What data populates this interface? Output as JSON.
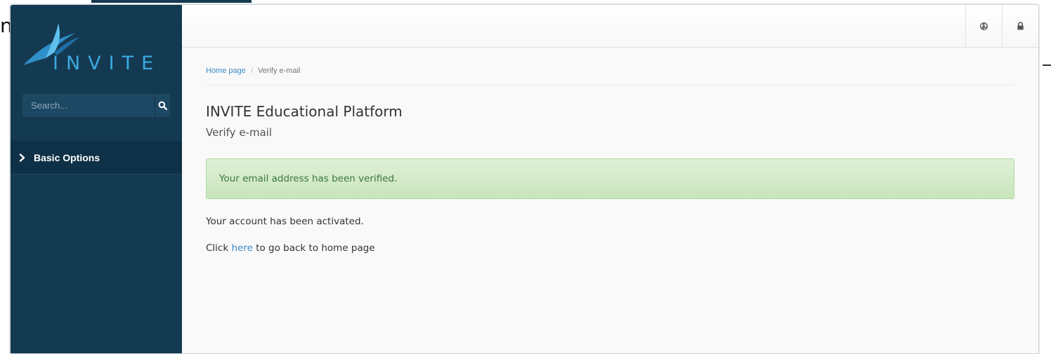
{
  "background": {
    "partial_letter": "n"
  },
  "sidebar": {
    "logo_text": "INVITE",
    "search": {
      "placeholder": "Search...",
      "button_icon": "search-icon"
    },
    "nav": [
      {
        "label": "Basic Options",
        "icon": "chevron-right-icon"
      }
    ]
  },
  "topbar": {
    "buttons": [
      {
        "icon": "globe-icon"
      },
      {
        "icon": "lock-icon"
      }
    ]
  },
  "breadcrumb": {
    "home": "Home page",
    "separator": "/",
    "current": "Verify e-mail"
  },
  "page": {
    "title": "INVITE Educational Platform",
    "subtitle": "Verify e-mail"
  },
  "alert": {
    "message": "Your email address has been verified."
  },
  "body": {
    "line1": "Your account has been activated.",
    "line2_prefix": "Click",
    "line2_link": "here",
    "line2_suffix": "to go back to home page"
  },
  "colors": {
    "sidebar": "#143a52",
    "accent": "#3aa9df",
    "link": "#3a8ac6",
    "alert_text": "#3c763d"
  }
}
